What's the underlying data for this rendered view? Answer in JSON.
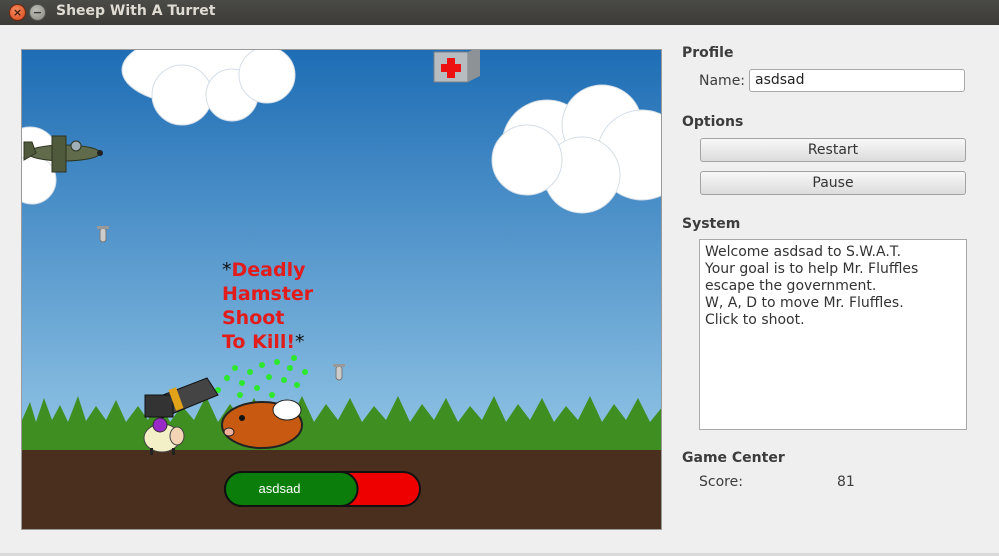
{
  "window": {
    "title": "Sheep With A Turret",
    "close_glyph": "×",
    "minimize_glyph": "−"
  },
  "game": {
    "caption_star": "*",
    "caption_lines": [
      "Deadly",
      "Hamster",
      "Shoot",
      "To Kill!"
    ],
    "player_name": "asdsad",
    "health_fraction": 0.68,
    "colors": {
      "sky_top": "#1e6db5",
      "sky_bottom": "#a9d6ef",
      "grass": "#3f8e22",
      "soil": "#4a2f1f",
      "health_green": "#0a7d0a",
      "health_red": "#ee0000",
      "caption_red": "#e21b1b"
    }
  },
  "profile": {
    "heading": "Profile",
    "name_label": "Name:",
    "name_value": "asdsad"
  },
  "options": {
    "heading": "Options",
    "restart_label": "Restart",
    "pause_label": "Pause"
  },
  "system": {
    "heading": "System",
    "messages": [
      "Welcome asdsad to S.W.A.T.",
      "Your goal is to help Mr. Fluffles escape the government.",
      "W, A, D to move Mr. Fluffles.",
      "Click to shoot."
    ]
  },
  "game_center": {
    "heading": "Game Center",
    "score_label": "Score:",
    "score_value": "81"
  }
}
